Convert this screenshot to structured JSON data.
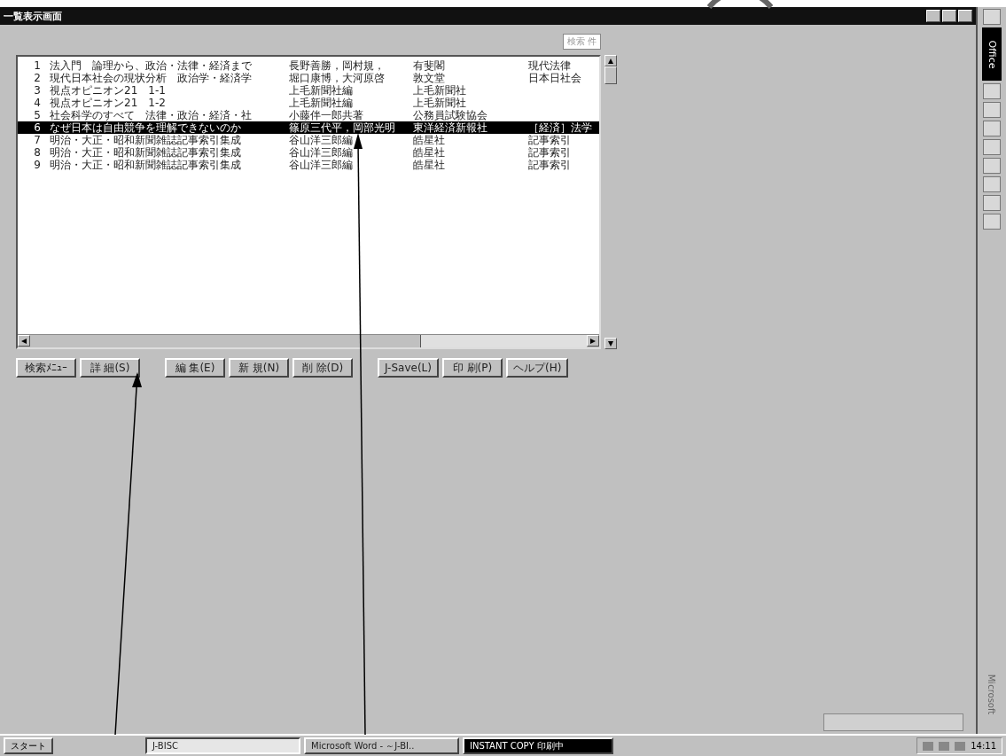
{
  "window": {
    "title": "一覧表示画面"
  },
  "hit_count": "検索 件",
  "rows": [
    {
      "no": "1",
      "title": "法入門　論理から、政治・法律・経済まで",
      "author": "長野善勝，岡村規，",
      "publisher": "有斐閣",
      "note": "現代法律",
      "selected": false
    },
    {
      "no": "2",
      "title": "現代日本社会の現状分析　政治学・経済学",
      "author": "堀口康博，大河原啓",
      "publisher": "敦文堂",
      "note": "日本日社会",
      "selected": false
    },
    {
      "no": "3",
      "title": "視点オピニオン21　1-1",
      "author": "上毛新聞社編",
      "publisher": "上毛新聞社",
      "note": "",
      "selected": false
    },
    {
      "no": "4",
      "title": "視点オピニオン21　1-2",
      "author": "上毛新聞社編",
      "publisher": "上毛新聞社",
      "note": "",
      "selected": false
    },
    {
      "no": "5",
      "title": "社会科学のすべて　法律・政治・経済・社",
      "author": "小藤伴一郎共著",
      "publisher": "公務員試験協会",
      "note": "",
      "selected": false
    },
    {
      "no": "6",
      "title": "なぜ日本は自由競争を理解できないのか",
      "author": "篠原三代平，岡部光明",
      "publisher": "東洋経済新報社",
      "note": "［経済］法学",
      "selected": true
    },
    {
      "no": "7",
      "title": "明治・大正・昭和新聞雑誌記事索引集成",
      "author": "谷山洋三郎編",
      "publisher": "皓星社",
      "note": "記事索引",
      "selected": false
    },
    {
      "no": "8",
      "title": "明治・大正・昭和新聞雑誌記事索引集成",
      "author": "谷山洋三郎編",
      "publisher": "皓星社",
      "note": "記事索引",
      "selected": false
    },
    {
      "no": "9",
      "title": "明治・大正・昭和新聞雑誌記事索引集成",
      "author": "谷山洋三郎編",
      "publisher": "皓星社",
      "note": "記事索引",
      "selected": false
    }
  ],
  "buttons": [
    {
      "label": "検索ﾒﾆｭｰ"
    },
    {
      "label": "詳 細(S)"
    },
    {
      "label": "編 集(E)"
    },
    {
      "label": "新 規(N)"
    },
    {
      "label": "削 除(D)"
    },
    {
      "label": "J-Save(L)"
    },
    {
      "label": "印 刷(P)"
    },
    {
      "label": "ヘルプ(H)"
    }
  ],
  "office_bar": {
    "title": "Office",
    "footer": "Microsoft"
  },
  "taskbar": {
    "start": "スタート",
    "tasks": [
      {
        "label": "J-BISC",
        "selected": true
      },
      {
        "label": "Microsoft Word - ～J-BI..",
        "selected": false
      },
      {
        "label": "INSTANT COPY 印刷中",
        "selected": false,
        "kind": "dark"
      }
    ],
    "clock": "14:11"
  }
}
